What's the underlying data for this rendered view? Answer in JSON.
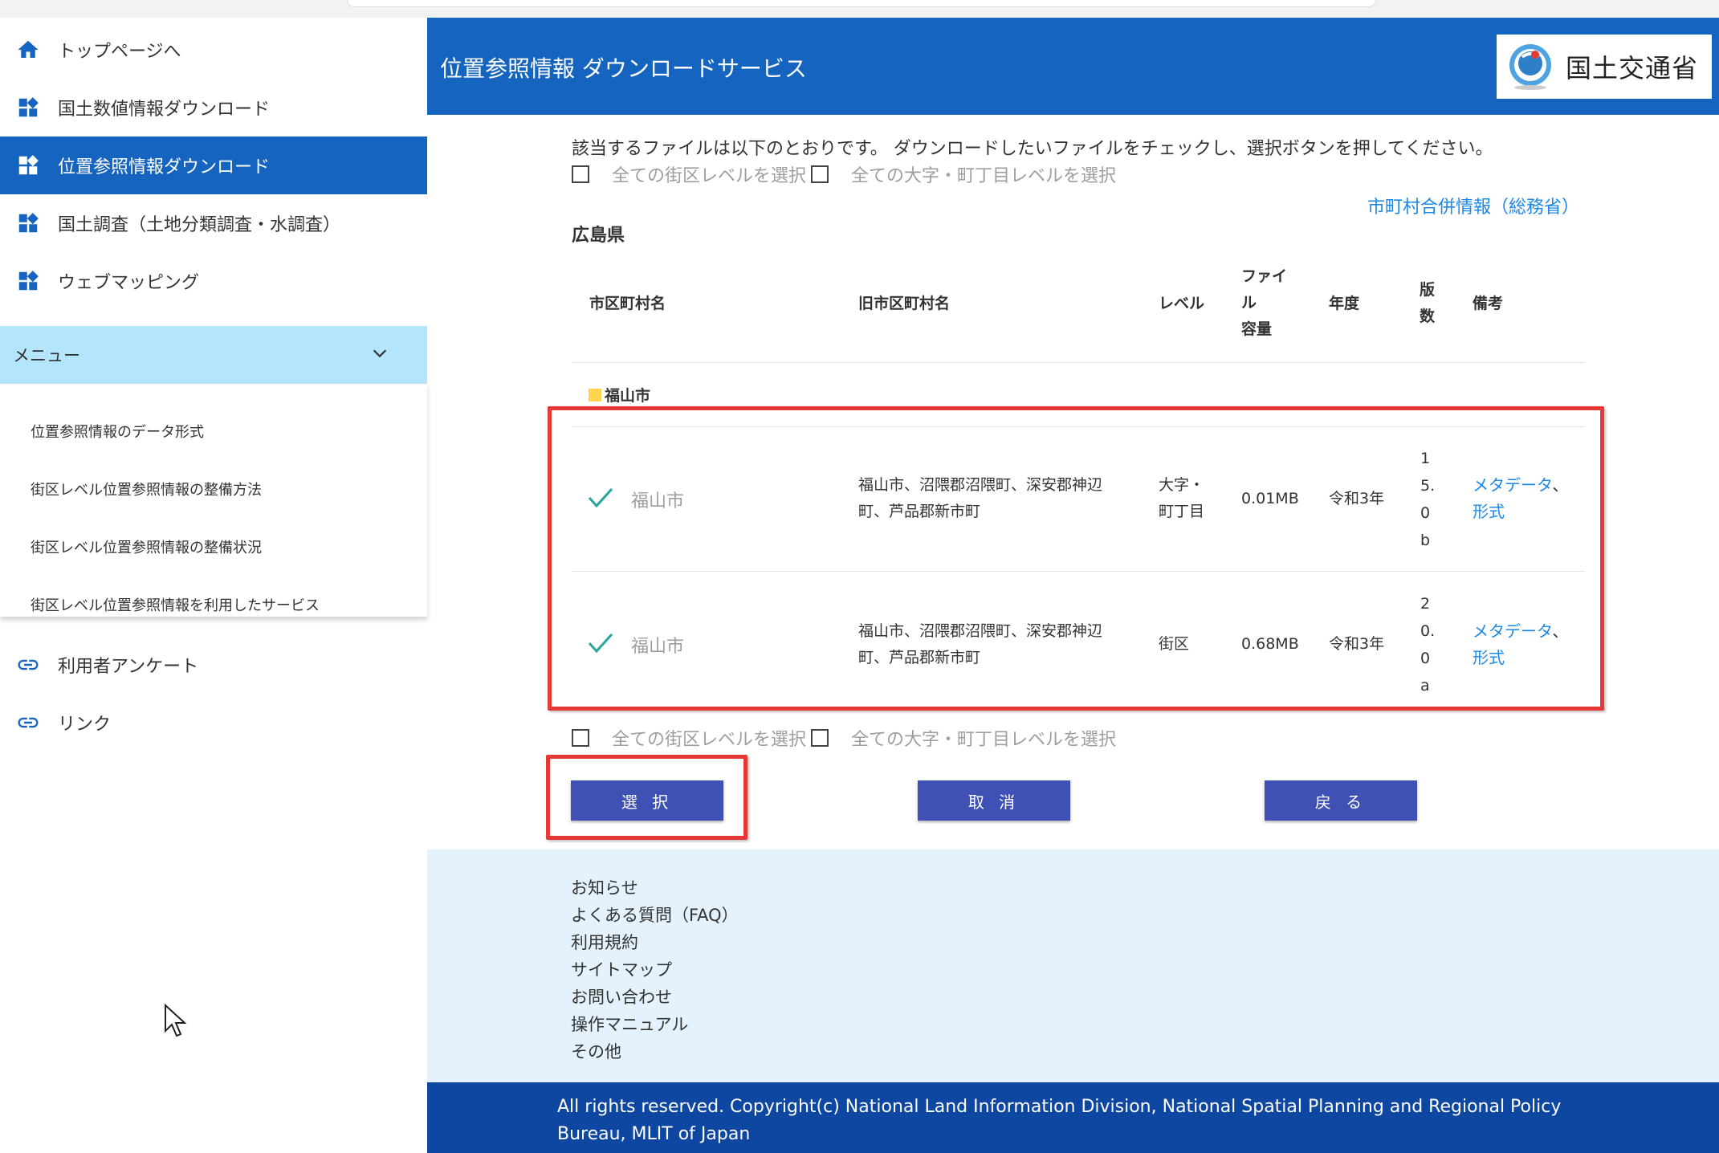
{
  "sidebar": {
    "nav": [
      {
        "label": "トップページへ",
        "icon": "home-icon"
      },
      {
        "label": "国土数値情報ダウンロード",
        "icon": "widgets-icon"
      },
      {
        "label": "位置参照情報ダウンロード",
        "icon": "widgets-icon"
      },
      {
        "label": "国土調査（土地分類調査・水調査）",
        "icon": "widgets-icon"
      },
      {
        "label": "ウェブマッピング",
        "icon": "widgets-icon"
      }
    ],
    "menu_label": "メニュー",
    "menu_items": [
      "位置参照情報のデータ形式",
      "街区レベル位置参照情報の整備方法",
      "街区レベル位置参照情報の整備状況",
      "街区レベル位置参照情報を利用したサービス"
    ],
    "bottom": [
      {
        "label": "利用者アンケート",
        "icon": "link-icon"
      },
      {
        "label": "リンク",
        "icon": "link-icon"
      }
    ]
  },
  "header": {
    "title": "位置参照情報 ダウンロードサービス",
    "logo_text": "国土交通省",
    "color": "#1565c0"
  },
  "main": {
    "intro": "該当するファイルは以下のとおりです。 ダウンロードしたいファイルをチェックし、選択ボタンを押してください。",
    "select_all_block": "全ての街区レベルを選択",
    "select_all_oaza": "全ての大字・町丁目レベルを選択",
    "merge_link": "市町村合併情報（総務省）",
    "prefecture": "広島県",
    "columns": {
      "city": "市区町村名",
      "old_city": "旧市区町村名",
      "level": "レベル",
      "size": "ファイル容量",
      "size_lines": [
        "ファイ",
        "ル",
        "容量"
      ],
      "year": "年度",
      "version": "版数",
      "version_lines": [
        "版",
        "数"
      ],
      "notes": "備考"
    },
    "city_group": "福山市",
    "rows": [
      {
        "checked": true,
        "city": "福山市",
        "old_city_lines": [
          "福山市、沼隈郡沼隈町、深安郡神辺",
          "町、芦品郡新市町"
        ],
        "level_lines": [
          "大字・",
          "町丁目"
        ],
        "size": "0.01MB",
        "year": "令和3年",
        "version_chars": [
          "1",
          "5.",
          "0",
          "b"
        ],
        "note_meta": "メタデータ",
        "note_sep": "、",
        "note_format": "形式"
      },
      {
        "checked": true,
        "city": "福山市",
        "old_city_lines": [
          "福山市、沼隈郡沼隈町、深安郡神辺",
          "町、芦品郡新市町"
        ],
        "level_lines": [
          "街区"
        ],
        "size": "0.68MB",
        "year": "令和3年",
        "version_chars": [
          "2",
          "0.",
          "0",
          "a"
        ],
        "note_meta": "メタデータ",
        "note_sep": "、",
        "note_format": "形式"
      }
    ],
    "buttons": {
      "select": "選 択",
      "cancel": "取 消",
      "back": "戻 る"
    },
    "highlight_color": "#e53935"
  },
  "footer": {
    "links": [
      "お知らせ",
      "よくある質問（FAQ）",
      "利用規約",
      "サイトマップ",
      "お問い合わせ",
      "操作マニュアル",
      "その他"
    ],
    "copyright": "All rights reserved. Copyright(c) National Land Information Division, National Spatial Planning and Regional Policy Bureau, MLIT of Japan"
  }
}
